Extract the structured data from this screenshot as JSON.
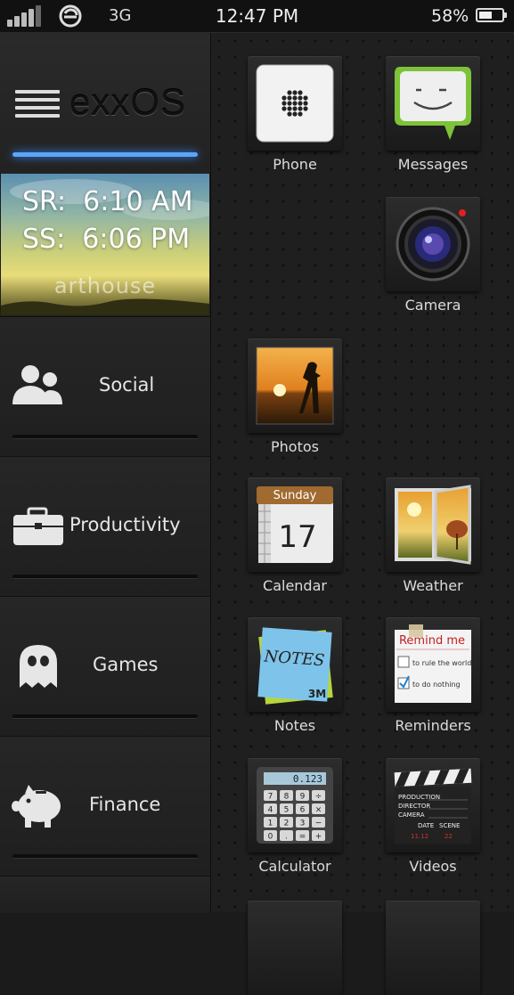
{
  "status_bar": {
    "network": "3G",
    "time": "12:47 PM",
    "battery": "58%",
    "battery_level": 0.58
  },
  "sidebar": {
    "brand": "exxOS",
    "widget": {
      "sunrise_label": "SR:",
      "sunrise_time": "6:10 AM",
      "sunset_label": "SS:",
      "sunset_time": "6:06 PM",
      "watermark": "arthouse"
    },
    "categories": [
      {
        "label": "Social",
        "icon": "users-icon"
      },
      {
        "label": "Productivity",
        "icon": "briefcase-icon"
      },
      {
        "label": "Games",
        "icon": "ghost-icon"
      },
      {
        "label": "Finance",
        "icon": "piggy-bank-icon"
      }
    ]
  },
  "apps": [
    {
      "label": "Phone",
      "icon": "phone-icon"
    },
    {
      "label": "Messages",
      "icon": "messages-icon"
    },
    {
      "label": "Camera",
      "icon": "camera-icon"
    },
    {
      "label": "Photos",
      "icon": "photos-icon"
    },
    {
      "label": "Calendar",
      "icon": "calendar-icon",
      "day_name": "Sunday",
      "day_number": "17"
    },
    {
      "label": "Weather",
      "icon": "weather-icon"
    },
    {
      "label": "Notes",
      "icon": "notes-icon",
      "note_title": "NOTES",
      "note_brand": "3M"
    },
    {
      "label": "Reminders",
      "icon": "reminders-icon",
      "title": "Remind me",
      "item1": "to rule the world",
      "item2": "to do nothing"
    },
    {
      "label": "Calculator",
      "icon": "calculator-icon",
      "display": "0.123",
      "keys": [
        "7",
        "8",
        "9",
        "÷",
        "4",
        "5",
        "6",
        "×",
        "1",
        "2",
        "3",
        "−",
        "0",
        ".",
        "=",
        "+"
      ]
    },
    {
      "label": "Videos",
      "icon": "videos-icon",
      "lines": [
        "PRODUCTION",
        "DIRECTOR",
        "CAMERA"
      ],
      "date_label": "DATE",
      "scene_label": "SCENE",
      "date_value": "11.12",
      "scene_value": "22"
    }
  ]
}
